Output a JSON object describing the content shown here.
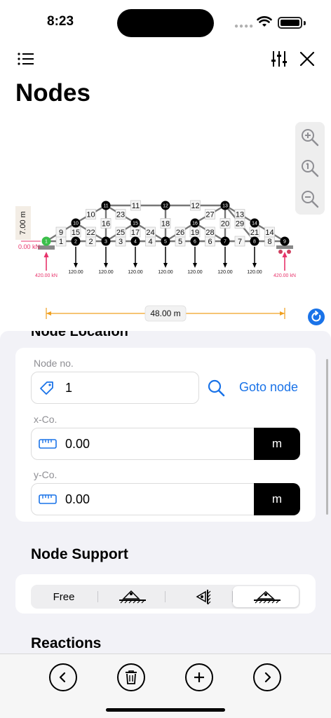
{
  "status": {
    "time": "8:23"
  },
  "page": {
    "title": "Nodes"
  },
  "diagram": {
    "height_label": "7.00 m",
    "width_label": "48.00 m",
    "reaction_left": "420.00 kN",
    "reaction_right": "420.00 kN",
    "moment_label": "0.00 kN",
    "member_labels": [
      "1",
      "2",
      "3",
      "4",
      "5",
      "6",
      "7",
      "8",
      "9",
      "10",
      "11",
      "12",
      "13",
      "14",
      "15",
      "16",
      "17",
      "18",
      "19",
      "20",
      "21",
      "22",
      "23",
      "24",
      "25",
      "26",
      "27",
      "28",
      "29"
    ],
    "node_labels": [
      "1",
      "2",
      "3",
      "4",
      "5",
      "6",
      "7",
      "8",
      "9",
      "10",
      "11",
      "12",
      "13",
      "14",
      "15",
      "16"
    ],
    "load_labels": [
      "120.00",
      "120.00",
      "120.00",
      "120.00",
      "120.00",
      "120.00",
      "120.00"
    ]
  },
  "node_location": {
    "section_title": "Node Location",
    "node_no_label": "Node no.",
    "node_no_value": "1",
    "goto_label": "Goto node",
    "x_label": "x-Co.",
    "x_value": "0.00",
    "x_unit": "m",
    "y_label": "y-Co.",
    "y_value": "0.00",
    "y_unit": "m"
  },
  "node_support": {
    "section_title": "Node Support",
    "options": [
      "Free",
      "pin-support",
      "roller-vertical-support",
      "fixed-support"
    ],
    "free_label": "Free",
    "selected_index": 3
  },
  "reactions": {
    "section_title": "Reactions"
  },
  "colors": {
    "accent": "#1a73e8",
    "reaction": "#e8336b",
    "support_node": "#3bbf4a"
  }
}
